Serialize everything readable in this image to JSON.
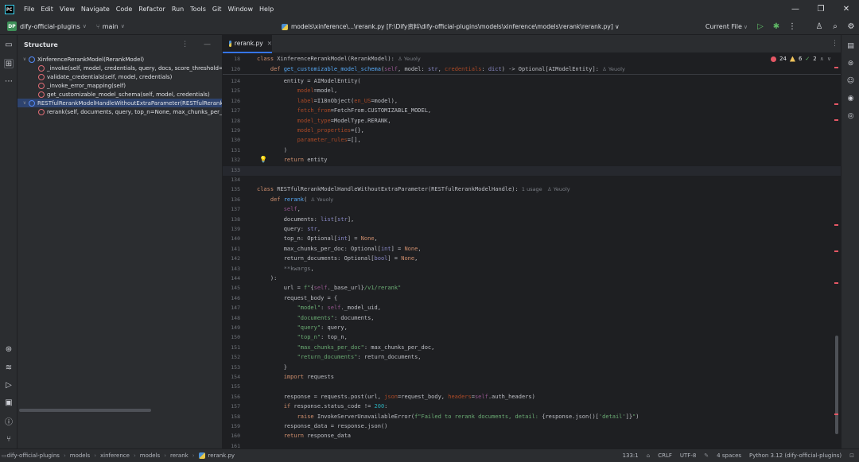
{
  "menu": [
    "File",
    "Edit",
    "View",
    "Navigate",
    "Code",
    "Refactor",
    "Run",
    "Tools",
    "Git",
    "Window",
    "Help"
  ],
  "toolbar": {
    "project_badge": "DP",
    "project": "dify-official-plugins",
    "branch": "main",
    "path": "models\\xinference\\...\\rerank.py [F:\\Dify资料\\dify-official-plugins\\models\\xinference\\models\\rerank\\rerank.py] ∨",
    "run_config": "Current File"
  },
  "structure": {
    "title": "Structure",
    "items": [
      {
        "label": "XinferenceRerankModel(RerankModel)",
        "kind": "class",
        "level": 0,
        "selected": false
      },
      {
        "label": "_invoke(self, model, credentials, query, docs, score_threshold=None",
        "kind": "method-private",
        "level": 1,
        "selected": false
      },
      {
        "label": "validate_credentials(self, model, credentials)",
        "kind": "method",
        "level": 1,
        "selected": false
      },
      {
        "label": "_invoke_error_mapping(self)",
        "kind": "property",
        "level": 1,
        "selected": false
      },
      {
        "label": "get_customizable_model_schema(self, model, credentials)",
        "kind": "method",
        "level": 1,
        "selected": false
      },
      {
        "label": "RESTfulRerankModelHandleWithoutExtraParameter(RESTfulRerankMod",
        "kind": "class",
        "level": 0,
        "selected": true
      },
      {
        "label": "rerank(self, documents, query, top_n=None, max_chunks_per_doc=N",
        "kind": "method",
        "level": 1,
        "selected": false
      }
    ]
  },
  "tab": {
    "label": "rerank.py"
  },
  "inspections": {
    "errors": "24",
    "warnings": "6",
    "ok": "2"
  },
  "sticky": [
    {
      "ln": "18",
      "parts": [
        [
          "kw",
          "class "
        ],
        [
          "cls",
          "XinferenceRerankModel(RerankModel):"
        ],
        [
          "hint",
          "  ♙ Yeuoly"
        ]
      ]
    },
    {
      "ln": "120",
      "parts": [
        [
          "kw",
          "    def "
        ],
        [
          "fn",
          "get_customizable_model_schema"
        ],
        [
          "cls",
          "("
        ],
        [
          "self",
          "self"
        ],
        [
          "cls",
          ", model: "
        ],
        [
          "bi",
          "str"
        ],
        [
          "cls",
          ", "
        ],
        [
          "par",
          "credentials"
        ],
        [
          "cls",
          ": "
        ],
        [
          "bi",
          "dict"
        ],
        [
          "cls",
          ") -> Optional[AIModelEntity]:"
        ],
        [
          "hint",
          "  ♙ Yeuoly"
        ]
      ]
    }
  ],
  "code": [
    {
      "ln": "124",
      "parts": [
        [
          "cls",
          "        entity = AIModelEntity("
        ]
      ]
    },
    {
      "ln": "125",
      "parts": [
        [
          "par",
          "            model"
        ],
        [
          "cls",
          "=model,"
        ]
      ]
    },
    {
      "ln": "126",
      "parts": [
        [
          "par",
          "            label"
        ],
        [
          "cls",
          "=I18nObject("
        ],
        [
          "par",
          "en_US"
        ],
        [
          "cls",
          "=model),"
        ]
      ]
    },
    {
      "ln": "127",
      "parts": [
        [
          "par",
          "            fetch_from"
        ],
        [
          "cls",
          "=FetchFrom.CUSTOMIZABLE_MODEL,"
        ]
      ]
    },
    {
      "ln": "128",
      "parts": [
        [
          "par",
          "            model_type"
        ],
        [
          "cls",
          "=ModelType.RERANK,"
        ]
      ]
    },
    {
      "ln": "129",
      "parts": [
        [
          "par",
          "            model_properties"
        ],
        [
          "cls",
          "={},"
        ]
      ]
    },
    {
      "ln": "130",
      "parts": [
        [
          "par",
          "            parameter_rules"
        ],
        [
          "cls",
          "=[],"
        ]
      ]
    },
    {
      "ln": "131",
      "parts": [
        [
          "cls",
          "        )"
        ]
      ]
    },
    {
      "ln": "132",
      "parts": [
        [
          "kw",
          "        return "
        ],
        [
          "cls",
          "entity"
        ]
      ]
    },
    {
      "ln": "133",
      "parts": [
        [
          "cls",
          ""
        ]
      ]
    },
    {
      "ln": "134",
      "parts": [
        [
          "cls",
          ""
        ]
      ]
    },
    {
      "ln": "135",
      "parts": [
        [
          "kw",
          "class "
        ],
        [
          "cls",
          "RESTfulRerankModelHandleWithoutExtraParameter(RESTfulRerankModelHandle):"
        ],
        [
          "hint",
          "  1 usage   ♙ Yeuoly"
        ]
      ]
    },
    {
      "ln": "136",
      "parts": [
        [
          "kw",
          "    def "
        ],
        [
          "fn",
          "rerank"
        ],
        [
          "cls",
          "("
        ],
        [
          "hint",
          "  ♙ Yeuoly"
        ]
      ]
    },
    {
      "ln": "137",
      "parts": [
        [
          "self",
          "        self"
        ],
        [
          "cls",
          ","
        ]
      ]
    },
    {
      "ln": "138",
      "parts": [
        [
          "cls",
          "        documents: "
        ],
        [
          "bi",
          "list"
        ],
        [
          "cls",
          "["
        ],
        [
          "bi",
          "str"
        ],
        [
          "cls",
          "],"
        ]
      ]
    },
    {
      "ln": "139",
      "parts": [
        [
          "cls",
          "        query: "
        ],
        [
          "bi",
          "str"
        ],
        [
          "cls",
          ","
        ]
      ]
    },
    {
      "ln": "140",
      "parts": [
        [
          "cls",
          "        top_n: Optional["
        ],
        [
          "bi",
          "int"
        ],
        [
          "cls",
          "] = "
        ],
        [
          "kw",
          "None"
        ],
        [
          "cls",
          ","
        ]
      ]
    },
    {
      "ln": "141",
      "parts": [
        [
          "cls",
          "        max_chunks_per_doc: Optional["
        ],
        [
          "bi",
          "int"
        ],
        [
          "cls",
          "] = "
        ],
        [
          "kw",
          "None"
        ],
        [
          "cls",
          ","
        ]
      ]
    },
    {
      "ln": "142",
      "parts": [
        [
          "cls",
          "        return_documents: Optional["
        ],
        [
          "bi",
          "bool"
        ],
        [
          "cls",
          "] = "
        ],
        [
          "kw",
          "None"
        ],
        [
          "cls",
          ","
        ]
      ]
    },
    {
      "ln": "143",
      "parts": [
        [
          "cm",
          "        **kwargs"
        ],
        [
          "cls",
          ","
        ]
      ]
    },
    {
      "ln": "144",
      "parts": [
        [
          "cls",
          "    ):"
        ]
      ]
    },
    {
      "ln": "145",
      "parts": [
        [
          "cls",
          "        url = "
        ],
        [
          "str",
          "f\""
        ],
        [
          "cls",
          "{"
        ],
        [
          "self",
          "self"
        ],
        [
          "cls",
          "._base_url}"
        ],
        [
          "str",
          "/v1/rerank\""
        ]
      ]
    },
    {
      "ln": "146",
      "parts": [
        [
          "cls",
          "        request_body = {"
        ]
      ]
    },
    {
      "ln": "147",
      "parts": [
        [
          "str",
          "            \"model\""
        ],
        [
          "cls",
          ": "
        ],
        [
          "self",
          "self"
        ],
        [
          "cls",
          "._model_uid,"
        ]
      ]
    },
    {
      "ln": "148",
      "parts": [
        [
          "str",
          "            \"documents\""
        ],
        [
          "cls",
          ": documents,"
        ]
      ]
    },
    {
      "ln": "149",
      "parts": [
        [
          "str",
          "            \"query\""
        ],
        [
          "cls",
          ": query,"
        ]
      ]
    },
    {
      "ln": "150",
      "parts": [
        [
          "str",
          "            \"top_n\""
        ],
        [
          "cls",
          ": top_n,"
        ]
      ]
    },
    {
      "ln": "151",
      "parts": [
        [
          "str",
          "            \"max_chunks_per_doc\""
        ],
        [
          "cls",
          ": max_chunks_per_doc,"
        ]
      ]
    },
    {
      "ln": "152",
      "parts": [
        [
          "str",
          "            \"return_documents\""
        ],
        [
          "cls",
          ": return_documents,"
        ]
      ]
    },
    {
      "ln": "153",
      "parts": [
        [
          "cls",
          "        }"
        ]
      ]
    },
    {
      "ln": "154",
      "parts": [
        [
          "kw",
          "        import "
        ],
        [
          "cls",
          "requests"
        ]
      ]
    },
    {
      "ln": "155",
      "parts": [
        [
          "cls",
          ""
        ]
      ]
    },
    {
      "ln": "156",
      "parts": [
        [
          "cls",
          "        response = requests.post(url, "
        ],
        [
          "par",
          "json"
        ],
        [
          "cls",
          "=request_body, "
        ],
        [
          "par",
          "headers"
        ],
        [
          "cls",
          "="
        ],
        [
          "self",
          "self"
        ],
        [
          "cls",
          ".auth_headers)"
        ]
      ]
    },
    {
      "ln": "157",
      "parts": [
        [
          "kw",
          "        if "
        ],
        [
          "cls",
          "response.status_code != "
        ],
        [
          "num",
          "200"
        ],
        [
          "cls",
          ":"
        ]
      ]
    },
    {
      "ln": "158",
      "parts": [
        [
          "kw",
          "            raise "
        ],
        [
          "cls",
          "InvokeServerUnavailableError("
        ],
        [
          "str",
          "f\"Failed to rerank documents, detail: "
        ],
        [
          "cls",
          "{response.json()["
        ],
        [
          "str",
          "'detail'"
        ],
        [
          "cls",
          "]}"
        ],
        [
          "str",
          "\""
        ],
        [
          "cls",
          ")"
        ]
      ]
    },
    {
      "ln": "159",
      "parts": [
        [
          "cls",
          "        response_data = response.json()"
        ]
      ]
    },
    {
      "ln": "160",
      "parts": [
        [
          "kw",
          "        return "
        ],
        [
          "cls",
          "response_data"
        ]
      ]
    },
    {
      "ln": "161",
      "parts": [
        [
          "cls",
          ""
        ]
      ]
    }
  ],
  "status": {
    "crumbs": [
      "dify-official-plugins",
      "models",
      "xinference",
      "models",
      "rerank",
      "rerank.py"
    ],
    "position": "133:1",
    "line_ending": "CRLF",
    "encoding": "UTF-8",
    "indent": "4 spaces",
    "interpreter": "Python 3.12 (dify-official-plugins)"
  }
}
